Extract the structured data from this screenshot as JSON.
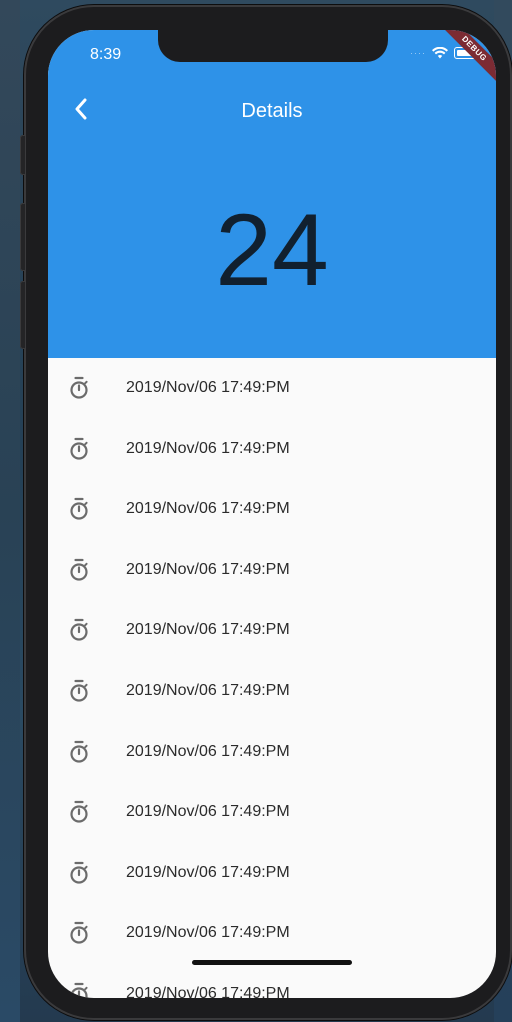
{
  "status_bar": {
    "time": "8:39",
    "signal": "····",
    "debug_label": "DEBUG"
  },
  "header": {
    "title": "Details",
    "back_icon": "chevron-left-icon",
    "count": "24",
    "background_color": "#2e92e8"
  },
  "list": {
    "item_icon": "stopwatch-icon",
    "items": [
      {
        "label": "2019/Nov/06  17:49:PM"
      },
      {
        "label": "2019/Nov/06  17:49:PM"
      },
      {
        "label": "2019/Nov/06  17:49:PM"
      },
      {
        "label": "2019/Nov/06  17:49:PM"
      },
      {
        "label": "2019/Nov/06  17:49:PM"
      },
      {
        "label": "2019/Nov/06  17:49:PM"
      },
      {
        "label": "2019/Nov/06  17:49:PM"
      },
      {
        "label": "2019/Nov/06  17:49:PM"
      },
      {
        "label": "2019/Nov/06  17:49:PM"
      },
      {
        "label": "2019/Nov/06  17:49:PM"
      },
      {
        "label": "2019/Nov/06  17:49:PM"
      }
    ]
  }
}
